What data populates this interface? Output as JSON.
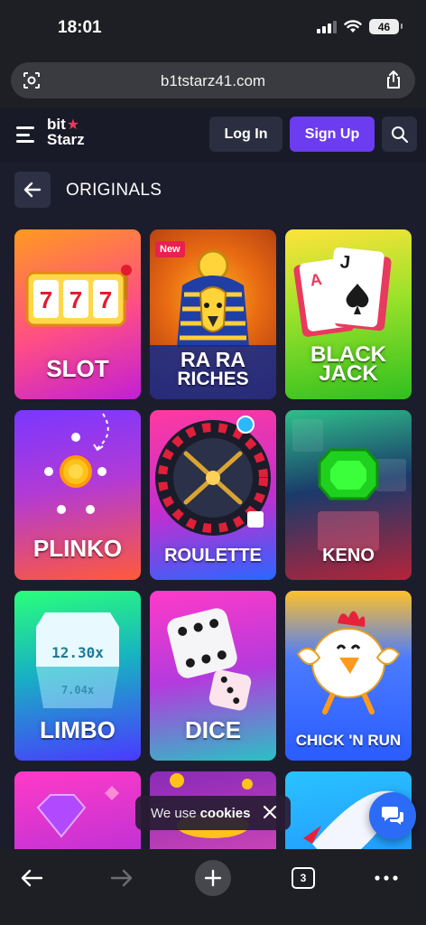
{
  "status_bar": {
    "time": "18:01",
    "battery": "46"
  },
  "browser": {
    "url": "b1tstarz41.com",
    "tab_count": "3"
  },
  "header": {
    "logo_line1": "bit",
    "logo_line2": "Starz",
    "login_label": "Log In",
    "signup_label": "Sign Up"
  },
  "section": {
    "title": "ORIGINALS"
  },
  "games": [
    {
      "title_line1": "SLOT",
      "title_line2": ""
    },
    {
      "title_line1": "RA RA",
      "title_line2": "RICHES",
      "badge": "New"
    },
    {
      "title_line1": "BLACK",
      "title_line2": "JACK"
    },
    {
      "title_line1": "PLINKO",
      "title_line2": ""
    },
    {
      "title_line1": "ROULETTE",
      "title_line2": ""
    },
    {
      "title_line1": "KENO",
      "title_line2": ""
    },
    {
      "title_line1": "LIMBO",
      "title_line2": "",
      "multiplier_top": "12.30x",
      "multiplier_bottom": "7.04x"
    },
    {
      "title_line1": "DICE",
      "title_line2": ""
    },
    {
      "title_line1": "CHICK 'N RUN",
      "title_line2": ""
    }
  ],
  "cookie_banner": {
    "prefix": "We use",
    "bold": "cookies"
  },
  "colors": {
    "accent": "#6b3cf0",
    "brand_star": "#e83a5e",
    "chat": "#2c6bf5"
  }
}
